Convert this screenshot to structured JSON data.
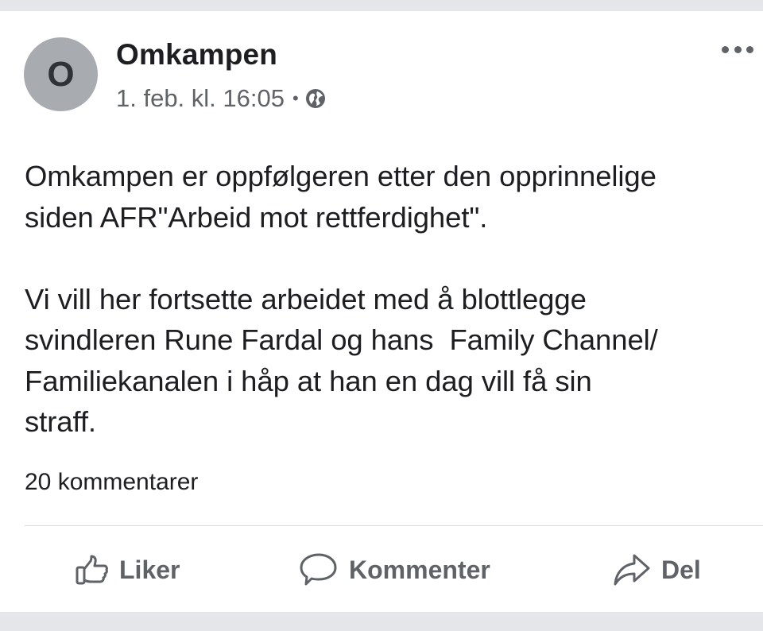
{
  "post": {
    "author": "Omkampen",
    "avatar_letter": "O",
    "timestamp": "1. feb. kl. 16:05",
    "separator": "•",
    "privacy_icon": "globe-icon",
    "more_icon": "more-options-icon",
    "paragraph_1": "Omkampen er oppfølgeren etter den opprinnelige\nsiden AFR\"Arbeid mot rettferdighet\".",
    "paragraph_2": "Vi vill her fortsette arbeidet med å blottlegge\nsvindleren Rune Fardal og hans  Family Channel/\nFamiliekanalen i håp at han en dag vill få sin\nstraff.",
    "comments_count": "20 kommentarer"
  },
  "actions": {
    "like_label": "Liker",
    "like_icon": "thumbs-up-icon",
    "comment_label": "Kommenter",
    "comment_icon": "comment-icon",
    "share_label": "Del",
    "share_icon": "share-icon"
  },
  "colors": {
    "background": "#e4e6ea",
    "card": "#ffffff",
    "text": "#1c1e21",
    "secondary_text": "#5f6368",
    "avatar": "#a8abb0"
  }
}
